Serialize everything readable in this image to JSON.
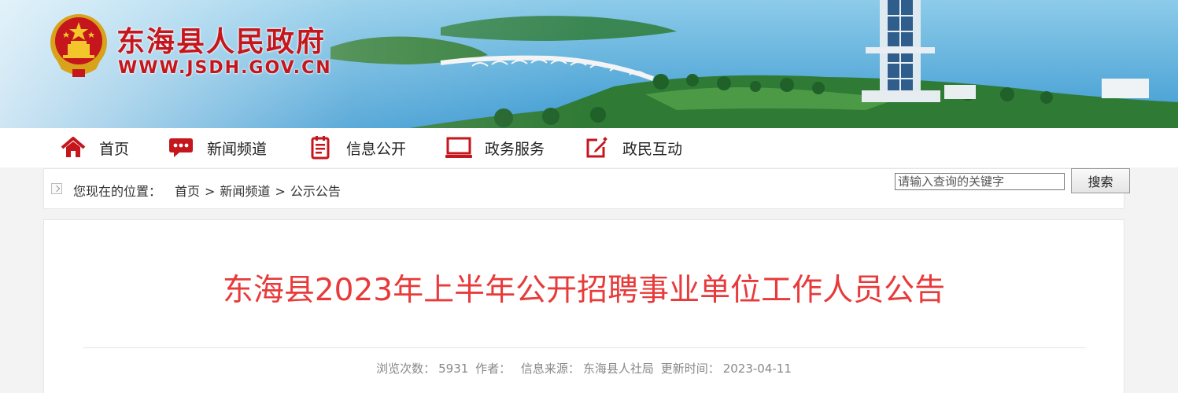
{
  "site": {
    "title": "东海县人民政府",
    "domain": "WWW.JSDH.GOV.CN"
  },
  "nav": {
    "items": [
      {
        "label": "首页",
        "icon": "home-icon"
      },
      {
        "label": "新闻频道",
        "icon": "chat-bubble-icon"
      },
      {
        "label": "信息公开",
        "icon": "document-icon"
      },
      {
        "label": "政务服务",
        "icon": "monitor-icon"
      },
      {
        "label": "政民互动",
        "icon": "edit-icon"
      }
    ]
  },
  "breadcrumb": {
    "prefix": "您现在的位置：",
    "items": [
      "首页",
      "新闻频道",
      "公示公告"
    ],
    "separator": ">"
  },
  "search": {
    "placeholder": "请输入查询的关键字",
    "button_label": "搜索"
  },
  "article": {
    "title": "东海县2023年上半年公开招聘事业单位工作人员公告",
    "meta": {
      "views_label": "浏览次数：",
      "views": "5931",
      "author_label": "作者：",
      "author": "",
      "source_label": "信息来源：",
      "source": "东海县人社局",
      "updated_label": "更新时间：",
      "updated": "2023-04-11"
    }
  },
  "colors": {
    "brand_red": "#c4161c",
    "title_red": "#e83a3a",
    "icon_red": "#c4161c"
  }
}
